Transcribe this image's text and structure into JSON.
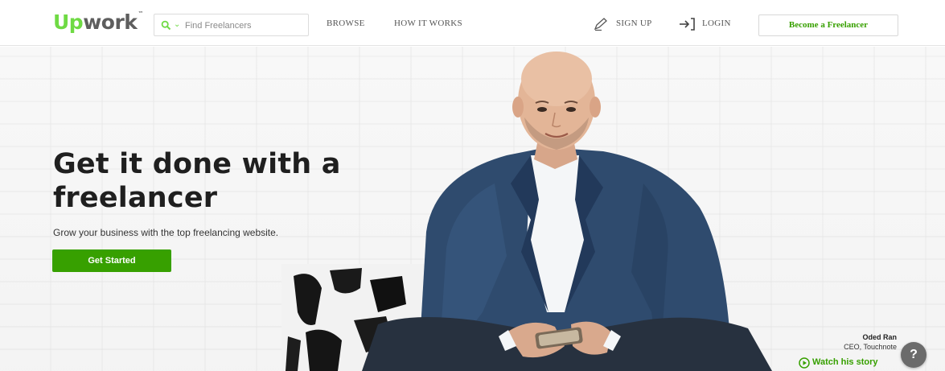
{
  "header": {
    "logo": {
      "up": "Up",
      "rest": "work",
      "tm": "™"
    },
    "search": {
      "placeholder": "Find Freelancers",
      "icon": "search-icon"
    },
    "nav": {
      "browse": "BROWSE",
      "how_it_works": "HOW IT WORKS"
    },
    "sign_up": {
      "label": "SIGN UP",
      "icon": "pencil-icon"
    },
    "login": {
      "label": "LOGIN",
      "icon": "login-arrow-icon"
    },
    "become_freelancer": "Become a Freelancer"
  },
  "hero": {
    "headline": "Get it done with a freelancer",
    "subline": "Grow your business with the top freelancing website.",
    "cta": "Get Started",
    "testimonial": {
      "name": "Oded Ran",
      "role": "CEO, Touchnote",
      "watch": "Watch his story",
      "watch_icon": "play-circle-icon"
    }
  },
  "help": {
    "label": "?"
  },
  "colors": {
    "brand_green": "#37a000",
    "logo_green": "#6fda44",
    "text_dark": "#1f1f1f"
  }
}
